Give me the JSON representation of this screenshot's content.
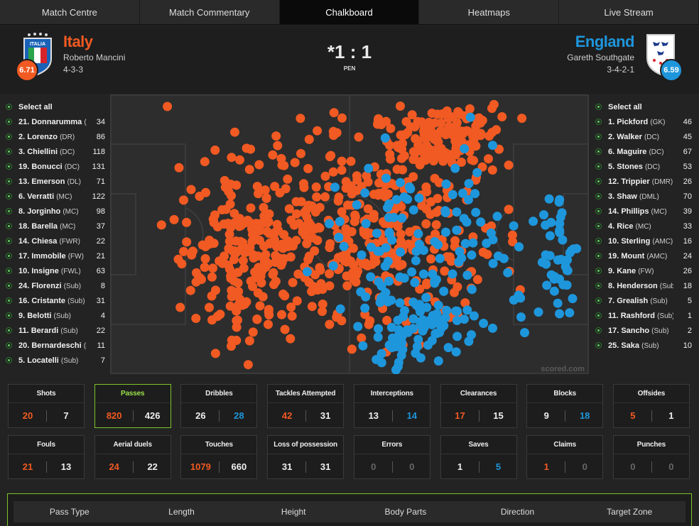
{
  "tabs": [
    {
      "label": "Match Centre"
    },
    {
      "label": "Match Commentary"
    },
    {
      "label": "Chalkboard",
      "active": true
    },
    {
      "label": "Heatmaps"
    },
    {
      "label": "Live Stream"
    }
  ],
  "colors": {
    "home": "#f15a22",
    "away": "#1e96dc",
    "selected": "#7cc52a",
    "muted": "#666666"
  },
  "home": {
    "name": "Italy",
    "manager": "Roberto Mancini",
    "formation": "4-3-3",
    "rating": "6.71",
    "badge_text": "ITALIA"
  },
  "away": {
    "name": "England",
    "manager": "Gareth Southgate",
    "formation": "3-4-2-1",
    "rating": "6.59"
  },
  "score": {
    "text": "*1 : 1",
    "note": "PEN"
  },
  "home_players": [
    {
      "name": "Select all",
      "pos": "",
      "count": ""
    },
    {
      "name": "21. Donnarumma",
      "pos": "(...",
      "count": "34"
    },
    {
      "name": "2. Lorenzo",
      "pos": "(DR)",
      "count": "86"
    },
    {
      "name": "3. Chiellini",
      "pos": "(DC)",
      "count": "118"
    },
    {
      "name": "19. Bonucci",
      "pos": "(DC)",
      "count": "131"
    },
    {
      "name": "13. Emerson",
      "pos": "(DL)",
      "count": "71"
    },
    {
      "name": "6. Verratti",
      "pos": "(MC)",
      "count": "122"
    },
    {
      "name": "8. Jorginho",
      "pos": "(MC)",
      "count": "98"
    },
    {
      "name": "18. Barella",
      "pos": "(MC)",
      "count": "37"
    },
    {
      "name": "14. Chiesa",
      "pos": "(FWR)",
      "count": "22"
    },
    {
      "name": "17. Immobile",
      "pos": "(FW)",
      "count": "21"
    },
    {
      "name": "10. Insigne",
      "pos": "(FWL)",
      "count": "63"
    },
    {
      "name": "24. Florenzi",
      "pos": "(Sub)",
      "count": "8"
    },
    {
      "name": "16. Cristante",
      "pos": "(Sub)",
      "count": "31"
    },
    {
      "name": "9. Belotti",
      "pos": "(Sub)",
      "count": "4"
    },
    {
      "name": "11. Berardi",
      "pos": "(Sub)",
      "count": "22"
    },
    {
      "name": "20. Bernardeschi",
      "pos": "(S...",
      "count": "11"
    },
    {
      "name": "5. Locatelli",
      "pos": "(Sub)",
      "count": "7"
    }
  ],
  "away_players": [
    {
      "name": "Select all",
      "pos": "",
      "count": ""
    },
    {
      "name": "1. Pickford",
      "pos": "(GK)",
      "count": "46"
    },
    {
      "name": "2. Walker",
      "pos": "(DC)",
      "count": "45"
    },
    {
      "name": "6. Maguire",
      "pos": "(DC)",
      "count": "67"
    },
    {
      "name": "5. Stones",
      "pos": "(DC)",
      "count": "53"
    },
    {
      "name": "12. Trippier",
      "pos": "(DMR)",
      "count": "26"
    },
    {
      "name": "3. Shaw",
      "pos": "(DML)",
      "count": "70"
    },
    {
      "name": "14. Phillips",
      "pos": "(MC)",
      "count": "39"
    },
    {
      "name": "4. Rice",
      "pos": "(MC)",
      "count": "33"
    },
    {
      "name": "10. Sterling",
      "pos": "(AMC)",
      "count": "16"
    },
    {
      "name": "19. Mount",
      "pos": "(AMC)",
      "count": "24"
    },
    {
      "name": "9. Kane",
      "pos": "(FW)",
      "count": "26"
    },
    {
      "name": "8. Henderson",
      "pos": "(Sub)",
      "count": "18"
    },
    {
      "name": "7. Grealish",
      "pos": "(Sub)",
      "count": "5"
    },
    {
      "name": "11. Rashford",
      "pos": "(Sub)",
      "count": "1"
    },
    {
      "name": "17. Sancho",
      "pos": "(Sub)",
      "count": "2"
    },
    {
      "name": "25. Saka",
      "pos": "(Sub)",
      "count": "10"
    }
  ],
  "stats": [
    {
      "label": "Shots",
      "home": "20",
      "away": "7",
      "home_color": "home",
      "away_color": "plain"
    },
    {
      "label": "Passes",
      "home": "820",
      "away": "426",
      "home_color": "home",
      "away_color": "plain",
      "selected": true
    },
    {
      "label": "Dribbles",
      "home": "26",
      "away": "28",
      "home_color": "plain",
      "away_color": "away"
    },
    {
      "label": "Tackles Attempted",
      "home": "42",
      "away": "31",
      "home_color": "home",
      "away_color": "plain"
    },
    {
      "label": "Interceptions",
      "home": "13",
      "away": "14",
      "home_color": "plain",
      "away_color": "away"
    },
    {
      "label": "Clearances",
      "home": "17",
      "away": "15",
      "home_color": "home",
      "away_color": "plain"
    },
    {
      "label": "Blocks",
      "home": "9",
      "away": "18",
      "home_color": "plain",
      "away_color": "away"
    },
    {
      "label": "Offsides",
      "home": "5",
      "away": "1",
      "home_color": "home",
      "away_color": "plain"
    },
    {
      "label": "Fouls",
      "home": "21",
      "away": "13",
      "home_color": "home",
      "away_color": "plain"
    },
    {
      "label": "Aerial duels",
      "home": "24",
      "away": "22",
      "home_color": "home",
      "away_color": "plain"
    },
    {
      "label": "Touches",
      "home": "1079",
      "away": "660",
      "home_color": "home",
      "away_color": "plain"
    },
    {
      "label": "Loss of possession",
      "home": "31",
      "away": "31",
      "home_color": "plain",
      "away_color": "plain"
    },
    {
      "label": "Errors",
      "home": "0",
      "away": "0",
      "home_color": "muted",
      "away_color": "muted"
    },
    {
      "label": "Saves",
      "home": "1",
      "away": "5",
      "home_color": "plain",
      "away_color": "away"
    },
    {
      "label": "Claims",
      "home": "1",
      "away": "0",
      "home_color": "home",
      "away_color": "muted"
    },
    {
      "label": "Punches",
      "home": "0",
      "away": "0",
      "home_color": "muted",
      "away_color": "muted"
    }
  ],
  "filters": [
    "Pass Type",
    "Length",
    "Height",
    "Body Parts",
    "Direction",
    "Target Zone"
  ],
  "watermark": "scored.com"
}
